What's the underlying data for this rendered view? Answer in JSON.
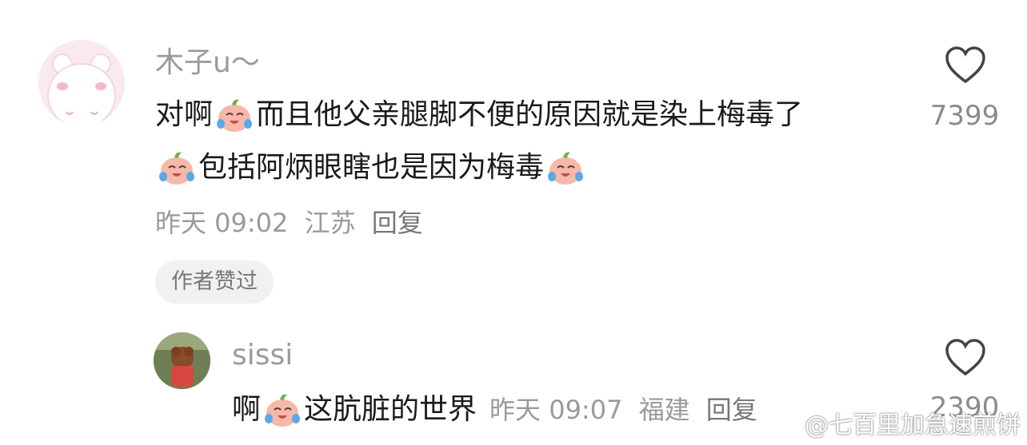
{
  "comments": [
    {
      "username": "木子u～",
      "line1_a": "对啊",
      "line1_b": "而且他父亲腿脚不便的原因就是染上梅毒了",
      "line2_a": "包括阿炳眼瞎也是因为梅毒",
      "time": "昨天 09:02",
      "location": "江苏",
      "reply_label": "回复",
      "badge": "作者赞过",
      "like_count": "7399"
    },
    {
      "username": "sissi",
      "text_a": "啊",
      "text_b": "这肮脏的世界",
      "time": "昨天 09:07",
      "location": "福建",
      "reply_label": "回复",
      "like_count": "2390"
    }
  ],
  "watermark": "@七百里加急速煎饼",
  "icons": [
    "heart-outline-icon",
    "crying-laughing-emoji-icon",
    "weibo-logo-icon"
  ]
}
